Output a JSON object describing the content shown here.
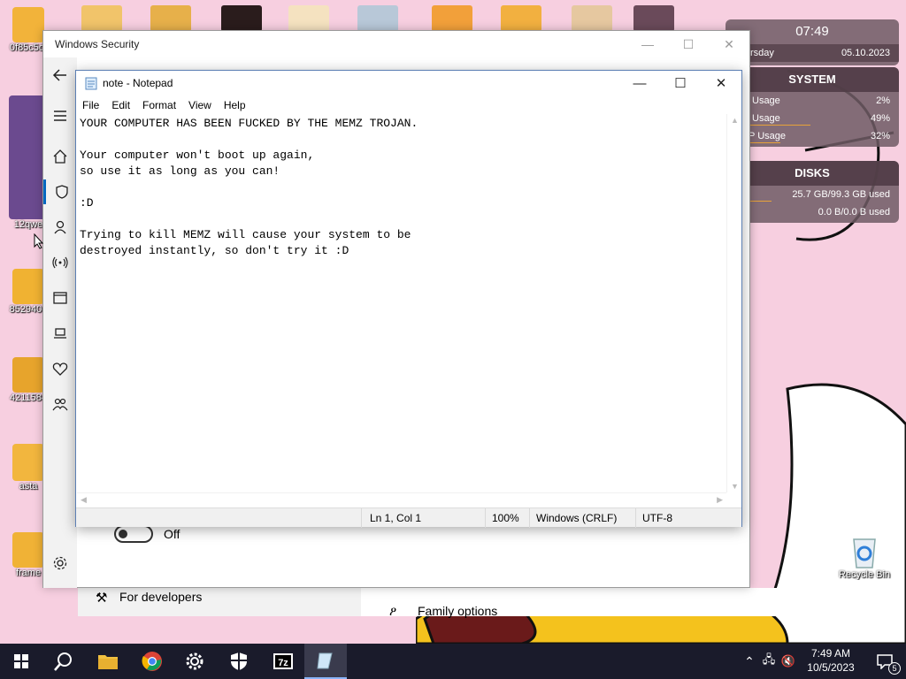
{
  "desktop": {
    "icons": [
      {
        "label": "0f85c5df",
        "color": "#f2b33a"
      },
      {
        "label": "12qwe",
        "color": "#6b4a8f"
      },
      {
        "label": "852940e",
        "color": "#f0b232"
      },
      {
        "label": "4211584",
        "color": "#e7a42c"
      },
      {
        "label": "asta",
        "color": "#f2b63e"
      },
      {
        "label": "frame",
        "color": "#f0b236"
      }
    ],
    "recycle_bin": "Recycle Bin",
    "top_thumbs": [
      "#f1c46a",
      "#e7b04a",
      "#f0b85a",
      "#2a1c1c",
      "#f5e2c0",
      "#b8c8d8",
      "#f2a03a",
      "#f2b040",
      "#e6c8a0",
      "#6a4a5a"
    ]
  },
  "widget_clock": {
    "time": "07:49",
    "day_partial": "rsday",
    "date": "05.10.2023"
  },
  "widget_system": {
    "title": "SYSTEM",
    "rows": [
      {
        "label": "Usage",
        "value": "2%",
        "fill": 0.02
      },
      {
        "label": "Usage",
        "value": "49%",
        "fill": 0.49
      },
      {
        "label": "P Usage",
        "value": "32%",
        "fill": 0.32
      }
    ]
  },
  "widget_disks": {
    "title": "DISKS",
    "rows": [
      {
        "value": "25.7 GB/99.3 GB used",
        "fill": 0.26
      },
      {
        "value": "0.0 B/0.0 B used",
        "fill": 0.0
      }
    ]
  },
  "security_window": {
    "title": "Windows Security",
    "toggle_label": "Off",
    "for_developers": "For developers",
    "family_options": "Family options"
  },
  "notepad": {
    "title": "note - Notepad",
    "menu": [
      "File",
      "Edit",
      "Format",
      "View",
      "Help"
    ],
    "content": "YOUR COMPUTER HAS BEEN FUCKED BY THE MEMZ TROJAN.\n\nYour computer won't boot up again,\nso use it as long as you can!\n\n:D\n\nTrying to kill MEMZ will cause your system to be\ndestroyed instantly, so don't try it :D",
    "status": {
      "position": "Ln 1, Col 1",
      "zoom": "100%",
      "line_ending": "Windows (CRLF)",
      "encoding": "UTF-8"
    }
  },
  "taskbar": {
    "time": "7:49 AM",
    "date": "10/5/2023",
    "notifications": "5"
  }
}
